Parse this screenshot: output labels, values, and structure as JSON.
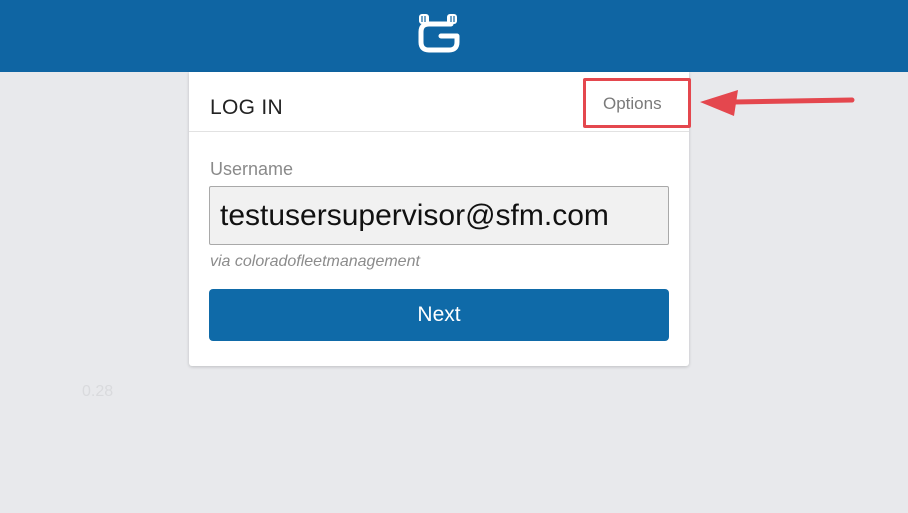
{
  "header": {
    "logo_icon": "g-robot-logo-icon",
    "brand_color": "#0f65a3"
  },
  "login": {
    "title": "LOG IN",
    "options_label": "Options",
    "username_label": "Username",
    "username_value": "testusersupervisor@sfm.com",
    "via_text": "via coloradofleetmanagement",
    "next_label": "Next",
    "button_color": "#0f6aa8"
  },
  "footer": {
    "version": "0.28"
  },
  "annotation": {
    "highlight_color": "#e4474e",
    "arrow_icon": "arrow-left-icon"
  }
}
